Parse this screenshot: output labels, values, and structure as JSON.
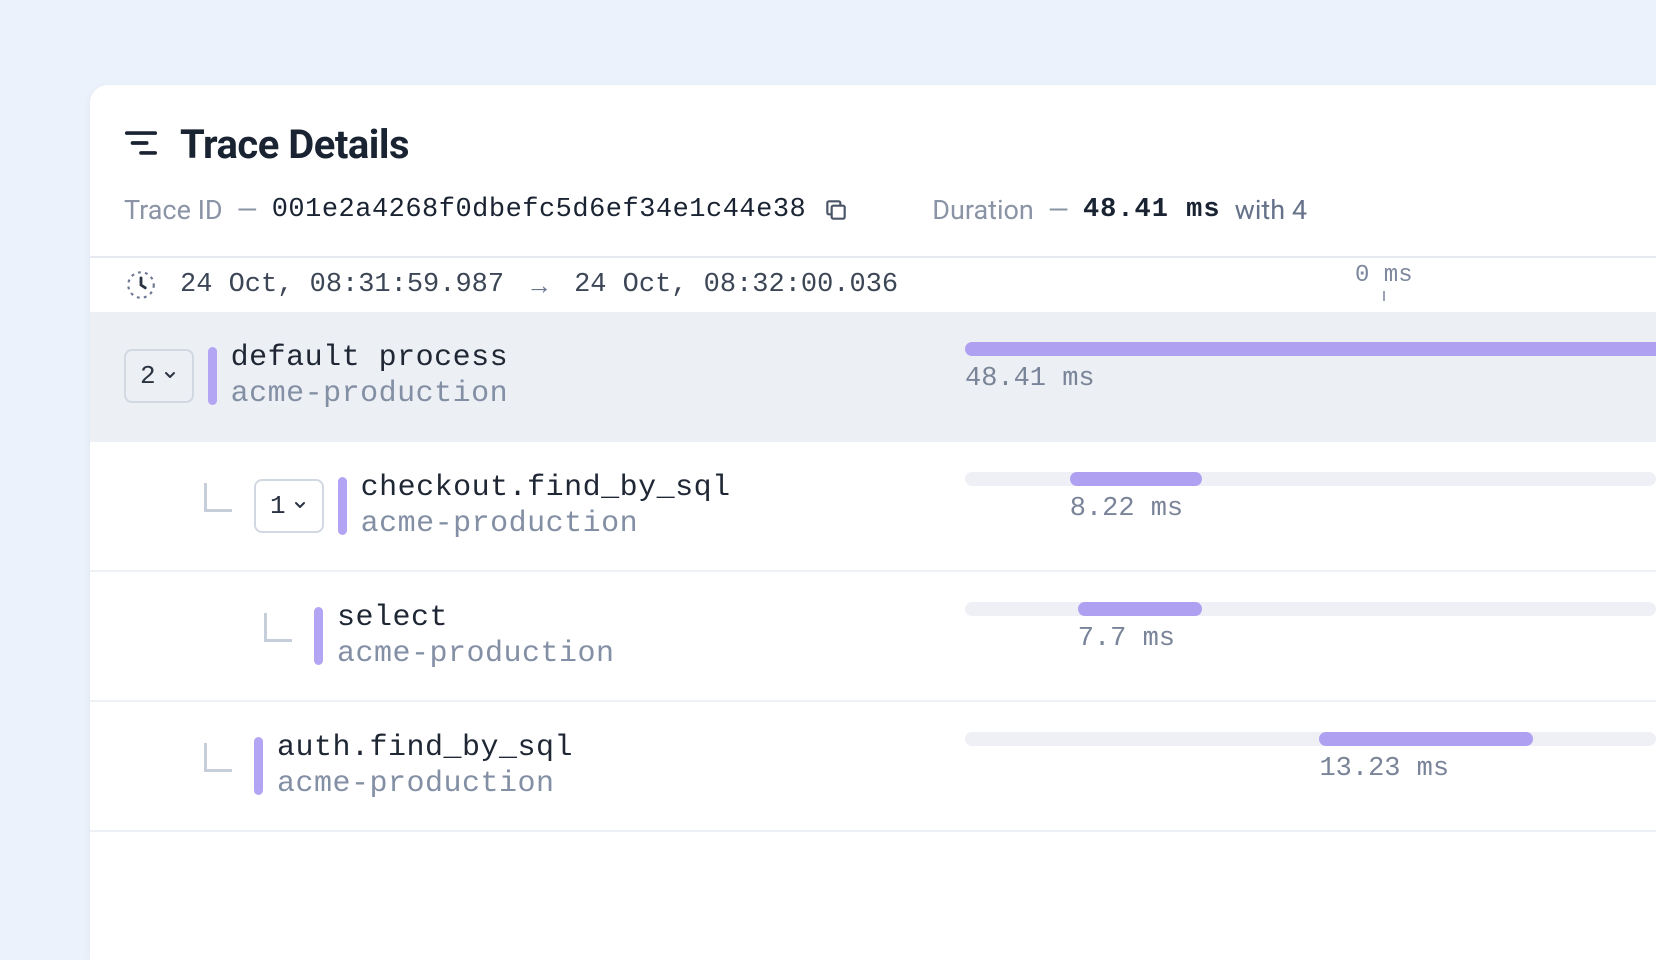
{
  "header": {
    "title": "Trace Details"
  },
  "meta": {
    "trace_id_label": "Trace ID",
    "dash": "—",
    "trace_id_value": "001e2a4268f0dbefc5d6ef34e1c44e38",
    "duration_label": "Duration",
    "duration_value": "48.41 ms",
    "duration_suffix": "with 4"
  },
  "timebar": {
    "start": "24 Oct, 08:31:59.987",
    "end": "24 Oct, 08:32:00.036",
    "tick0": "0 ms"
  },
  "total_ms": 48.41,
  "spans": [
    {
      "name": "default process",
      "service": "acme-production",
      "duration_label": "48.41 ms",
      "count": "2",
      "indent": 0,
      "offset_ms": 0,
      "dur_ms": 48.41,
      "root": true,
      "has_count": true
    },
    {
      "name": "checkout.find_by_sql",
      "service": "acme-production",
      "duration_label": "8.22 ms",
      "count": "1",
      "indent": 1,
      "offset_ms": 6.5,
      "dur_ms": 8.22,
      "root": false,
      "has_count": true
    },
    {
      "name": "select",
      "service": "acme-production",
      "duration_label": "7.7 ms",
      "indent": 2,
      "offset_ms": 7.0,
      "dur_ms": 7.7,
      "root": false,
      "has_count": false
    },
    {
      "name": "auth.find_by_sql",
      "service": "acme-production",
      "duration_label": "13.23 ms",
      "indent": 1,
      "offset_ms": 22.0,
      "dur_ms": 13.23,
      "root": false,
      "has_count": false
    }
  ]
}
